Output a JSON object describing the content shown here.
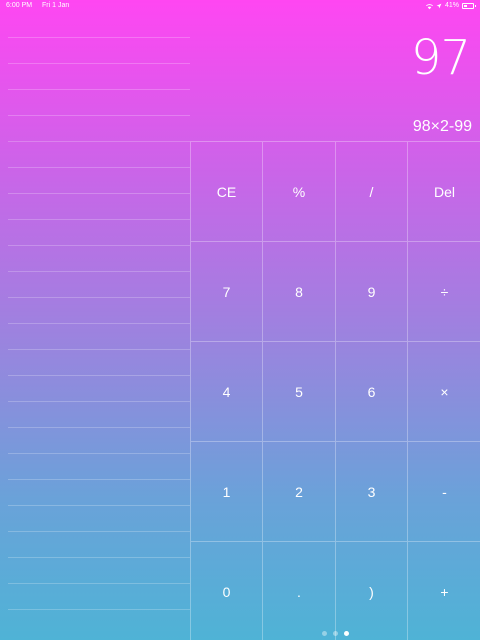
{
  "status_bar": {
    "time": "6:00 PM",
    "date": "Fri 1 Jan",
    "battery_percent": "41%",
    "battery_level": 0.41
  },
  "display": {
    "result": "97",
    "expression": "98×2-99"
  },
  "keypad": {
    "keys": [
      {
        "label": "CE",
        "name": "clear-entry-button"
      },
      {
        "label": "%",
        "name": "percent-button"
      },
      {
        "label": "/",
        "name": "slash-button"
      },
      {
        "label": "Del",
        "name": "delete-button"
      },
      {
        "label": "7",
        "name": "digit-7-button"
      },
      {
        "label": "8",
        "name": "digit-8-button"
      },
      {
        "label": "9",
        "name": "digit-9-button"
      },
      {
        "label": "÷",
        "name": "divide-button"
      },
      {
        "label": "4",
        "name": "digit-4-button"
      },
      {
        "label": "5",
        "name": "digit-5-button"
      },
      {
        "label": "6",
        "name": "digit-6-button"
      },
      {
        "label": "×",
        "name": "multiply-button"
      },
      {
        "label": "1",
        "name": "digit-1-button"
      },
      {
        "label": "2",
        "name": "digit-2-button"
      },
      {
        "label": "3",
        "name": "digit-3-button"
      },
      {
        "label": "-",
        "name": "minus-button"
      },
      {
        "label": "0",
        "name": "digit-0-button"
      },
      {
        "label": ".",
        "name": "decimal-point-button"
      },
      {
        "label": ")",
        "name": "close-paren-button"
      },
      {
        "label": "+",
        "name": "plus-button"
      }
    ]
  },
  "page_indicator": {
    "count": 3,
    "active_index": 2
  }
}
